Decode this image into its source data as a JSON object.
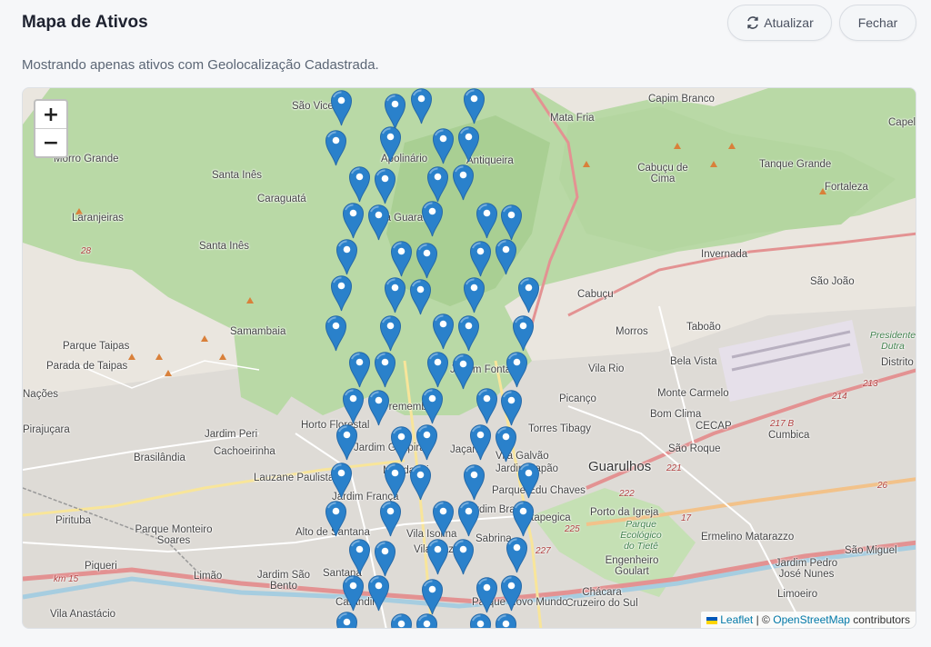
{
  "header": {
    "title": "Mapa de Ativos",
    "refresh_label": "Atualizar",
    "refresh_icon": "refresh-icon",
    "close_label": "Fechar"
  },
  "subtitle": "Mostrando apenas ativos com Geolocalização Cadastrada.",
  "map": {
    "zoom_in": "+",
    "zoom_out": "−",
    "attribution": {
      "leaflet": "Leaflet",
      "separator": "| ©",
      "osm": "OpenStreetMap",
      "suffix": "contributors"
    },
    "marker_color": "#2a81cb",
    "places": [
      {
        "name": "São Vicente"
      },
      {
        "name": "Morro Grande"
      },
      {
        "name": "Santa Inês"
      },
      {
        "name": "Caraguatá"
      },
      {
        "name": "Laranjeiras"
      },
      {
        "name": "Santa Inês"
      },
      {
        "name": "Apolinário"
      },
      {
        "name": "Antiqueira"
      },
      {
        "name": "Capim Branco"
      },
      {
        "name": "Mata Fria"
      },
      {
        "name": "Cabuçu de Cima"
      },
      {
        "name": "Tanque Grande"
      },
      {
        "name": "Fortaleza"
      },
      {
        "name": "Capel"
      },
      {
        "name": "Invernada"
      },
      {
        "name": "São João"
      },
      {
        "name": "Cabuçu"
      },
      {
        "name": "Samambaia"
      },
      {
        "name": "Parque Taipas"
      },
      {
        "name": "Parada de Taipas"
      },
      {
        "name": "Morros"
      },
      {
        "name": "Taboão"
      },
      {
        "name": "Vila Rio"
      },
      {
        "name": "Bela Vista"
      },
      {
        "name": "Picanço"
      },
      {
        "name": "Monte Carmelo"
      },
      {
        "name": "Bom Clima"
      },
      {
        "name": "Torres Tibagy"
      },
      {
        "name": "CECAP"
      },
      {
        "name": "Cumbica"
      },
      {
        "name": "São Roque"
      },
      {
        "name": "Guarulhos"
      },
      {
        "name": "Jardim Peri"
      },
      {
        "name": "Cachoeirinha"
      },
      {
        "name": "Brasilândia"
      },
      {
        "name": "Lauzane Paulista"
      },
      {
        "name": "Horto Florestal"
      },
      {
        "name": "Jardim Guapira"
      },
      {
        "name": "Pirituba"
      },
      {
        "name": "Parque Monteiro Soares"
      },
      {
        "name": "Alto de Santana"
      },
      {
        "name": "Piqueri"
      },
      {
        "name": "Limão"
      },
      {
        "name": "Jardim São Bento"
      },
      {
        "name": "Vila Anastácio"
      },
      {
        "name": "Porto da Igreja"
      },
      {
        "name": "Itapegica"
      },
      {
        "name": "Ermelino Matarazzo"
      },
      {
        "name": "São Miguel"
      },
      {
        "name": "Engenheiro Goulart"
      },
      {
        "name": "Jardim Pedro José Nunes"
      },
      {
        "name": "Chácara Cruzeiro do Sul"
      },
      {
        "name": "Limoeiro"
      },
      {
        "name": "Parque Ecológico do Tietê"
      },
      {
        "name": "Presidente Dutra"
      },
      {
        "name": "Distrito"
      },
      {
        "name": "Tremembé"
      },
      {
        "name": "Vila Mazzei"
      },
      {
        "name": "Jaçanã"
      },
      {
        "name": "Jardim Brasil"
      },
      {
        "name": "Sabrina"
      },
      {
        "name": "Parque Novo Mundo"
      },
      {
        "name": "Carandiru"
      },
      {
        "name": "Santana"
      },
      {
        "name": "Jardim França"
      },
      {
        "name": "Mandaqui"
      },
      {
        "name": "Parque Edu Chaves"
      },
      {
        "name": "Vila Isolina"
      },
      {
        "name": "Jardim Fontalis"
      },
      {
        "name": "Jardim Japão"
      },
      {
        "name": "Vila Galvão"
      },
      {
        "name": "Nações"
      },
      {
        "name": "Pirajuçara"
      },
      {
        "name": "Vila Guaraú"
      }
    ],
    "roads": [
      "28",
      "214",
      "213",
      "217 B",
      "221",
      "222",
      "225",
      "227",
      "26",
      "17",
      "km 15"
    ]
  }
}
